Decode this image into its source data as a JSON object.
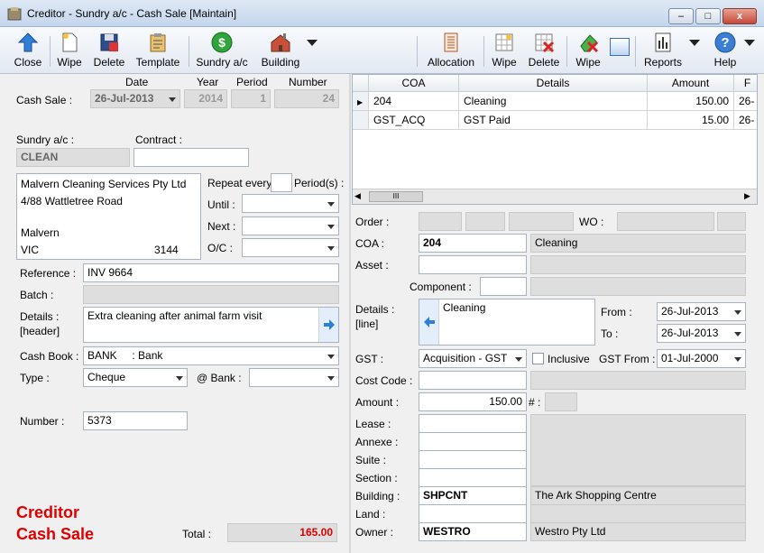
{
  "window": {
    "title": "Creditor - Sundry a/c - Cash Sale [Maintain]",
    "min": "–",
    "max": "□",
    "close": "x"
  },
  "toolbar": {
    "close": "Close",
    "wipe": "Wipe",
    "delete": "Delete",
    "template": "Template",
    "sundry": "Sundry a/c",
    "building": "Building",
    "allocation": "Allocation",
    "wipe2": "Wipe",
    "delete2": "Delete",
    "wipe3": "Wipe",
    "reports": "Reports",
    "help": "Help"
  },
  "header": {
    "date_label": "Date",
    "year_label": "Year",
    "period_label": "Period",
    "number_label": "Number",
    "cash_sale_label": "Cash Sale :",
    "date": "26-Jul-2013",
    "year": "2014",
    "period": "1",
    "number": "24"
  },
  "sundry": {
    "label": "Sundry a/c :",
    "value": "CLEAN",
    "contract_label": "Contract :",
    "contract": ""
  },
  "address": {
    "line1": "Malvern Cleaning Services Pty Ltd",
    "line2": "4/88 Wattletree Road",
    "line3": "Malvern",
    "state": "VIC",
    "postcode": "3144"
  },
  "repeat": {
    "label": "Repeat every",
    "periods_label": "Period(s) :",
    "until_label": "Until :",
    "next_label": "Next :",
    "oc_label": "O/C :"
  },
  "left": {
    "reference_label": "Reference :",
    "reference": "INV 9664",
    "batch_label": "Batch :",
    "details_label1": "Details :",
    "details_label2": "[header]",
    "details": "Extra cleaning after animal farm visit",
    "cashbook_label": "Cash Book :",
    "cashbook": "BANK     : Bank",
    "type_label": "Type :",
    "type": "Cheque",
    "atbank_label": "@ Bank :",
    "number_label": "Number :",
    "number": "5373"
  },
  "footer": {
    "line1": "Creditor",
    "line2": "Cash Sale",
    "total_label": "Total :",
    "total": "165.00"
  },
  "grid": {
    "columns": [
      "COA",
      "Details",
      "Amount",
      "F"
    ],
    "rows": [
      {
        "coa": "204",
        "details": "Cleaning",
        "amount": "150.00",
        "f": "26-"
      },
      {
        "coa": "GST_ACQ",
        "details": "GST Paid",
        "amount": "15.00",
        "f": "26-"
      }
    ],
    "scroll_thumb": "III"
  },
  "right": {
    "order_label": "Order :",
    "wo_label": "WO :",
    "coa_label": "COA :",
    "coa": "204",
    "coa_desc": "Cleaning",
    "asset_label": "Asset :",
    "component_label": "Component :",
    "details_label1": "Details :",
    "details_label2": "[line]",
    "details": "Cleaning",
    "from_label": "From :",
    "from": "26-Jul-2013",
    "to_label": "To :",
    "to": "26-Jul-2013",
    "gst_label": "GST :",
    "gst": "Acquisition - GST",
    "inclusive_label": "Inclusive",
    "gstfrom_label": "GST From :",
    "gstfrom": "01-Jul-2000",
    "costcode_label": "Cost Code :",
    "amount_label": "Amount :",
    "amount": "150.00",
    "hash_label": "# :",
    "lease_label": "Lease :",
    "annexe_label": "Annexe :",
    "suite_label": "Suite :",
    "section_label": "Section :",
    "building_label": "Building :",
    "building": "SHPCNT",
    "building_desc": "The Ark Shopping Centre",
    "land_label": "Land :",
    "owner_label": "Owner :",
    "owner": "WESTRO",
    "owner_desc": "Westro Pty Ltd"
  },
  "colors": {
    "accent_red": "#e00000",
    "grid_header": "#e8ecf1"
  }
}
